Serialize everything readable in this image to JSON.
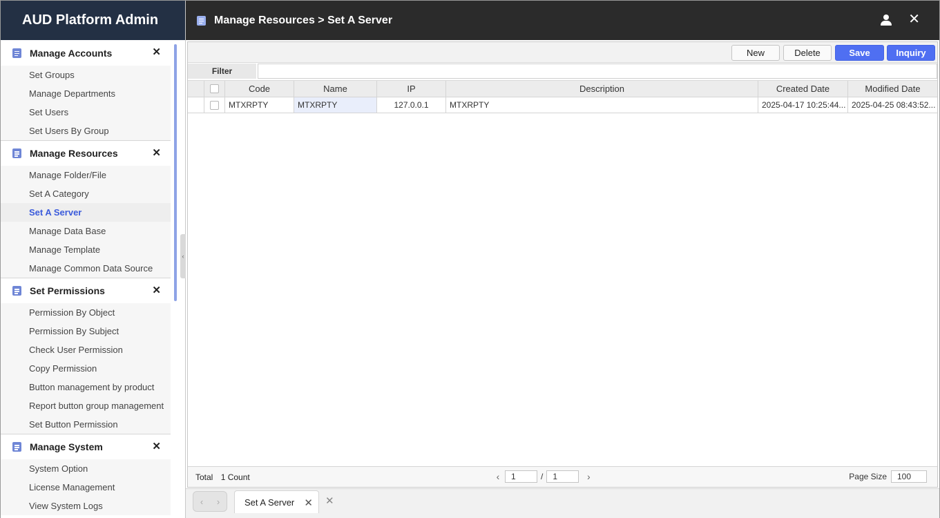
{
  "app": {
    "title": "AUD Platform Admin"
  },
  "header": {
    "breadcrumb": "Manage Resources > Set A Server"
  },
  "sidebar": {
    "groups": [
      {
        "title": "Manage Accounts",
        "items": [
          "Set Groups",
          "Manage Departments",
          "Set Users",
          "Set Users By Group"
        ]
      },
      {
        "title": "Manage Resources",
        "items": [
          "Manage Folder/File",
          "Set A Category",
          "Set A Server",
          "Manage Data Base",
          "Manage Template",
          "Manage Common Data Source"
        ]
      },
      {
        "title": "Set Permissions",
        "items": [
          "Permission By Object",
          "Permission By Subject",
          "Check User Permission",
          "Copy Permission",
          "Button management by product",
          "Report button group management",
          "Set Button Permission"
        ]
      },
      {
        "title": "Manage System",
        "items": [
          "System Option",
          "License Management",
          "View System Logs"
        ]
      }
    ],
    "active_item": "Set A Server"
  },
  "toolbar": {
    "new_label": "New",
    "delete_label": "Delete",
    "save_label": "Save",
    "inquiry_label": "Inquiry"
  },
  "filter": {
    "label": "Filter",
    "value": ""
  },
  "table": {
    "columns": [
      "Code",
      "Name",
      "IP",
      "Description",
      "Created Date",
      "Modified Date"
    ],
    "rows": [
      {
        "code": "MTXRPTY",
        "name": "MTXRPTY",
        "ip": "127.0.0.1",
        "description": "MTXRPTY",
        "created": "2025-04-17 10:25:44...",
        "modified": "2025-04-25 08:43:52..."
      }
    ]
  },
  "footer": {
    "total_label": "Total",
    "count": "1 Count",
    "page": "1",
    "page_total": "1",
    "page_size_label": "Page Size",
    "page_size": "100"
  },
  "tabs": {
    "open": [
      "Set A Server"
    ]
  },
  "colors": {
    "sidebar_brand_bg": "#233044",
    "topbar_bg": "#2b2b2b",
    "accent": "#4f6ff2",
    "active_nav": "#3b5bdb"
  }
}
